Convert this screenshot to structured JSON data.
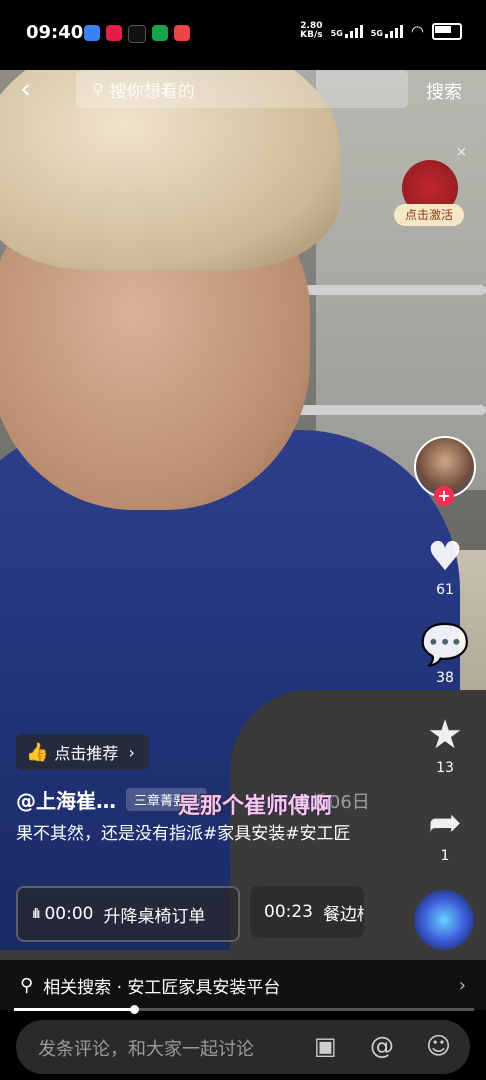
{
  "status": {
    "time": "09:40",
    "net_speed_value": "2.80",
    "net_speed_unit": "KB/s",
    "signal1": "5G",
    "signal2": "5G",
    "app_icon_colors": [
      "#3b82f6",
      "#e11d48",
      "#111111",
      "#16a34a",
      "#ef4444"
    ]
  },
  "top": {
    "search_placeholder": "搜你想看的",
    "search_button": "搜索"
  },
  "promo": {
    "label": "点击激活",
    "close": "×"
  },
  "actions": {
    "like_count": "61",
    "comment_count": "38",
    "favorite_count": "13",
    "share_count": "1"
  },
  "post": {
    "recommend": "点击推荐",
    "author": "@上海崔…",
    "aux_tag": "三章菁要卡",
    "subtitle": "是那个崔师傅啊",
    "date_faint": "06月06日",
    "caption": "果不其然，还是没有指派#家具安装#安工匠"
  },
  "chapters": [
    {
      "time": "00:00",
      "title": "升降桌椅订单"
    },
    {
      "time": "00:23",
      "title": "餐边柜"
    }
  ],
  "related": {
    "text": "相关搜索 · 安工匠家具安装平台"
  },
  "playback": {
    "progress": 0.26
  },
  "comment": {
    "placeholder": "发条评论，和大家一起讨论"
  },
  "colors": {
    "accent": "#fe2c55",
    "shirt": "#2d3f8c"
  }
}
